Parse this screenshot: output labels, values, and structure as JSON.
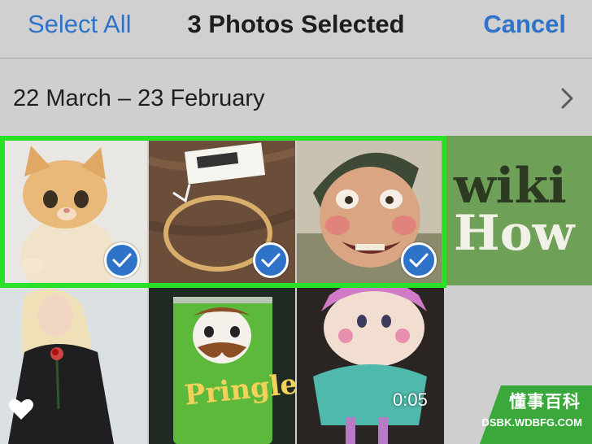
{
  "navbar": {
    "select_all": "Select All",
    "title": "3 Photos Selected",
    "cancel": "Cancel"
  },
  "section": {
    "date_range": "22 March – 23 February"
  },
  "grid": {
    "photos": [
      {
        "subject": "kitten",
        "selected": true
      },
      {
        "subject": "bracelet with price tag",
        "selected": true
      },
      {
        "subject": "puppet face",
        "selected": true
      },
      {
        "subject": "wikiHow logo",
        "selected": false,
        "logo_text": [
          "wiki",
          "How"
        ]
      },
      {
        "subject": "woman in black dress with rose",
        "selected": false,
        "favorite": true
      },
      {
        "subject": "pringles can",
        "selected": false,
        "can_text": "Pringles"
      },
      {
        "subject": "doll",
        "selected": false,
        "duration": "0:05"
      }
    ]
  },
  "watermark": {
    "line1": "懂事百科",
    "line2": "DSBK.WDBFG.COM"
  },
  "colors": {
    "accent": "#2f73c8",
    "selection_frame": "#29e227",
    "watermark_bg": "#3aa83a"
  }
}
